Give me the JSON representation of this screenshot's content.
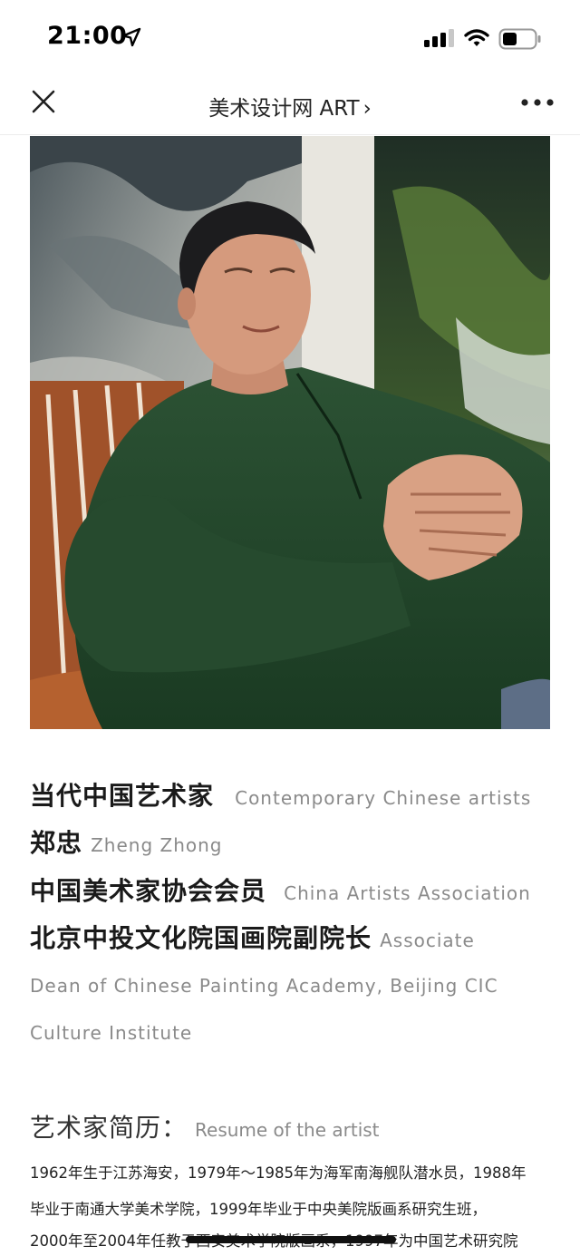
{
  "status_bar": {
    "time": "21:00"
  },
  "nav": {
    "title": "美术设计网 ART",
    "chevron": "›"
  },
  "photo": {
    "alt": "portrait photo"
  },
  "info": [
    {
      "zh": "当代中国艺术家",
      "en": "Contemporary Chinese artists"
    },
    {
      "zh": "郑忠",
      "en": "Zheng Zhong"
    },
    {
      "zh": "中国美术家协会会员",
      "en": "China Artists Association"
    },
    {
      "zh": "北京中投文化院国画院副院长",
      "en": "Associate"
    }
  ],
  "info_cont": [
    "Dean of Chinese Painting Academy, Beijing CIC",
    "Culture Institute"
  ],
  "resume": {
    "zh": "艺术家简历：",
    "en": "Resume of the artist"
  },
  "bio": [
    "1962年生于江苏海安，1979年～1985年为海军南海舰队潜水员，1988年",
    "毕业于南通大学美术学院，1999年毕业于中央美院版画系研究生班，",
    "2000年至2004年任教于西安美术学院版画系，1997年为中国艺术研究院"
  ]
}
